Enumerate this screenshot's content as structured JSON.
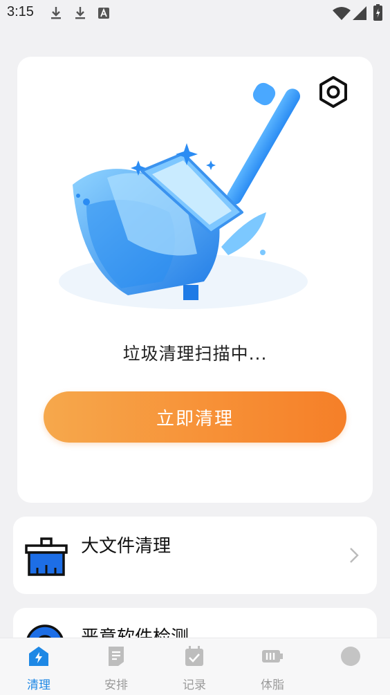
{
  "status_bar": {
    "time": "3:15",
    "icons": [
      "download-icon",
      "download-icon",
      "font-app-icon",
      "wifi-icon",
      "cell-signal-icon",
      "battery-charging-icon"
    ]
  },
  "hero": {
    "settings_icon": "hexagon-settings-icon",
    "illustration": "blue-broom-illustration",
    "scan_status": "垃圾清理扫描中...",
    "clean_button": "立即清理",
    "button_colors": [
      "#f6a84c",
      "#f57f28"
    ]
  },
  "features": [
    {
      "label": "大文件清理",
      "icon": "broom-brush-icon"
    },
    {
      "label": "恶意软件检测",
      "icon": "shield-scan-icon"
    }
  ],
  "nav": {
    "items": [
      {
        "label": "清理",
        "icon": "cleanup-bolt-icon",
        "active": true
      },
      {
        "label": "安排",
        "icon": "document-icon",
        "active": false
      },
      {
        "label": "记录",
        "icon": "calendar-check-icon",
        "active": false
      },
      {
        "label": "体脂",
        "icon": "battery-icon",
        "active": false
      },
      {
        "label": "",
        "icon": "circle-icon",
        "active": false
      }
    ],
    "active_color": "#1e88e5",
    "inactive_color": "#9a9a9a"
  }
}
